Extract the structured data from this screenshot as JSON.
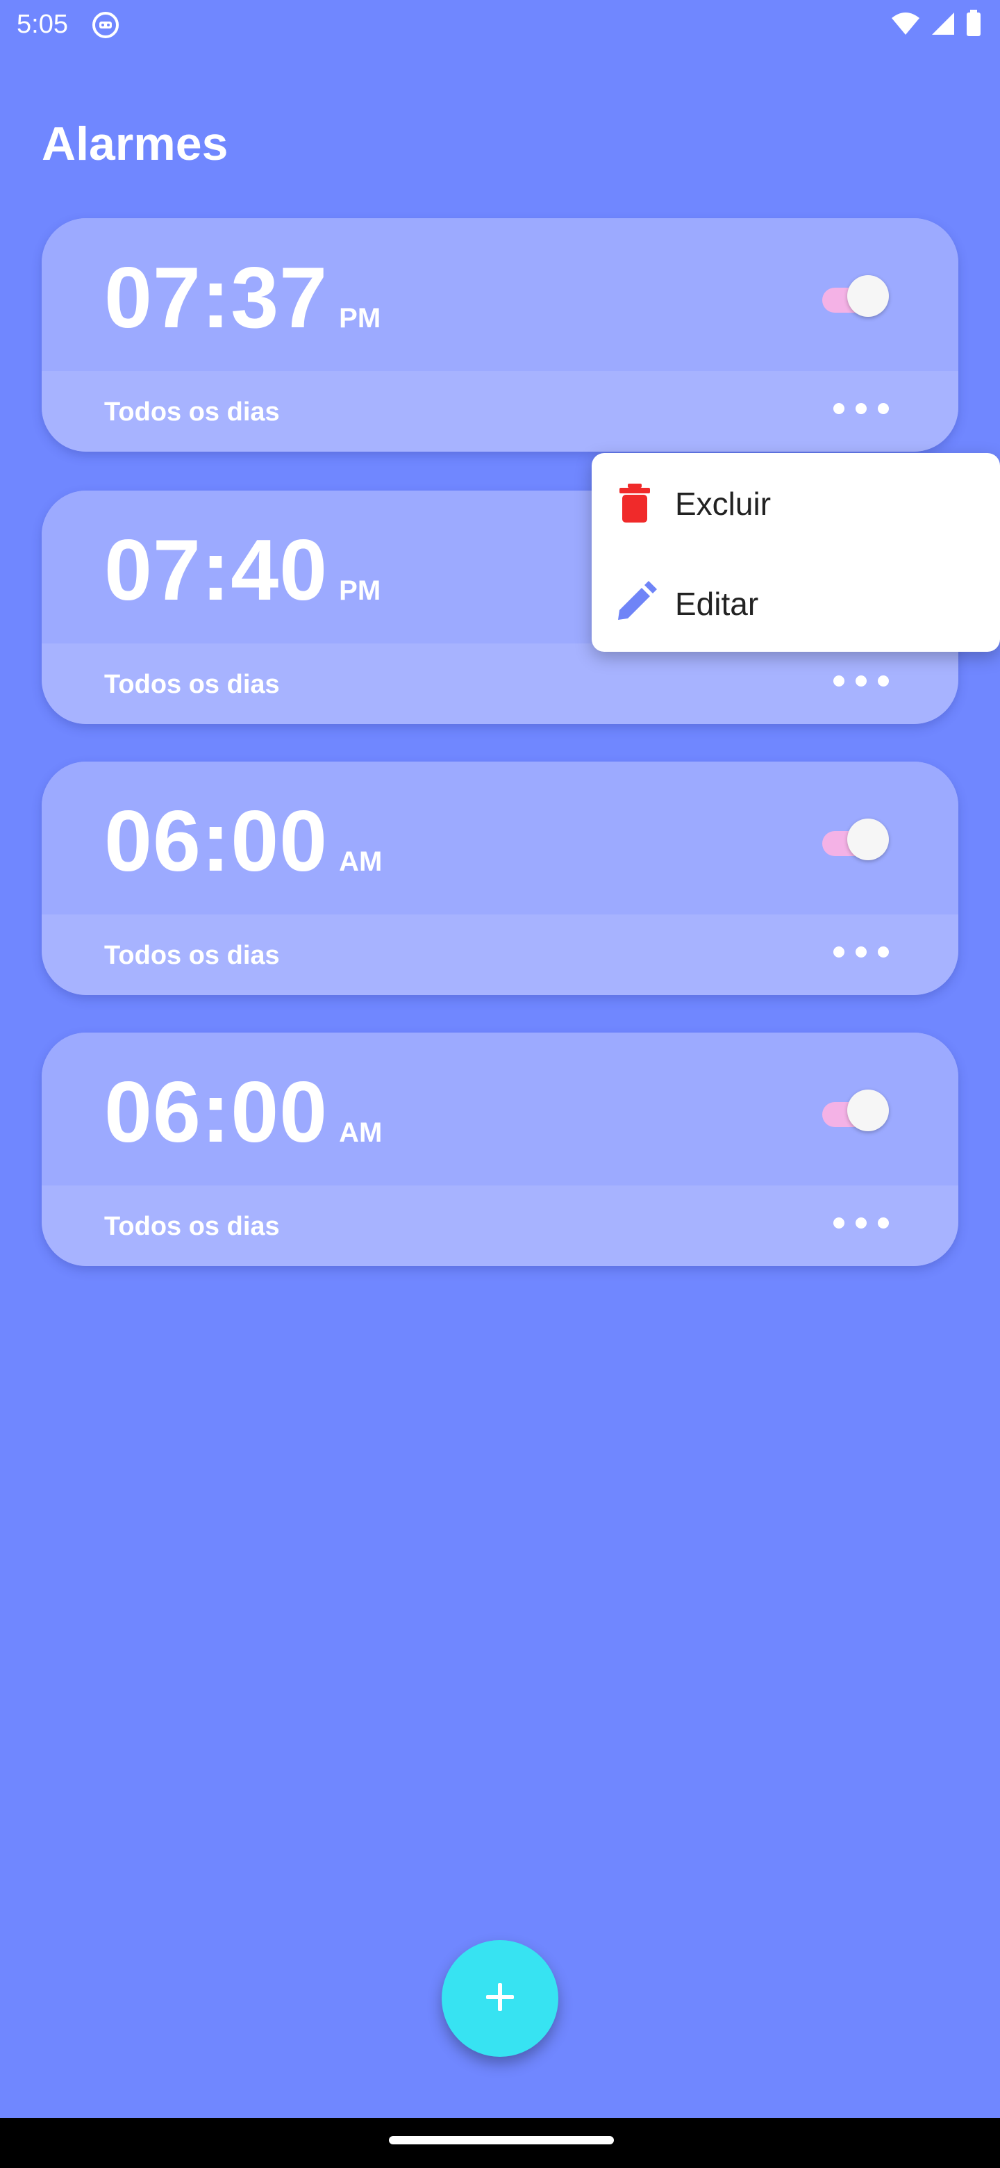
{
  "status_bar": {
    "time": "5:05",
    "icons": [
      "notification-icon",
      "wifi-icon",
      "signal-icon",
      "battery-icon"
    ]
  },
  "page": {
    "title": "Alarmes"
  },
  "alarms": [
    {
      "time": "07:37",
      "period": "PM",
      "repeat": "Todos os dias",
      "enabled": true
    },
    {
      "time": "07:40",
      "period": "PM",
      "repeat": "Todos os dias",
      "enabled": true
    },
    {
      "time": "06:00",
      "period": "AM",
      "repeat": "Todos os dias",
      "enabled": true
    },
    {
      "time": "06:00",
      "period": "AM",
      "repeat": "Todos os dias",
      "enabled": true
    }
  ],
  "context_menu": {
    "items": [
      {
        "label": "Excluir",
        "icon": "trash-icon",
        "color": "#F02A2A"
      },
      {
        "label": "Editar",
        "icon": "pencil-icon",
        "color": "#6F84F7"
      }
    ]
  },
  "fab": {
    "icon": "plus-icon"
  },
  "colors": {
    "background": "#7087FF",
    "card": "#9CAAFF",
    "card_footer": "#A7B3FF",
    "toggle_track": "#F4B2E6",
    "fab": "#37E3F2"
  }
}
